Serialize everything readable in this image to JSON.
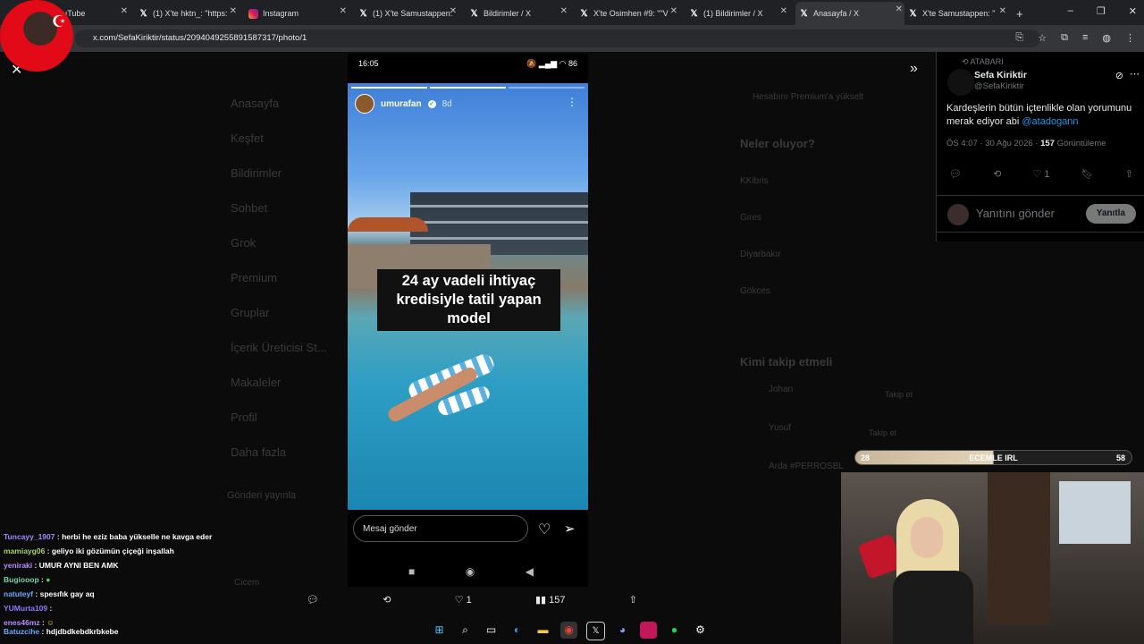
{
  "browser": {
    "tabs": [
      {
        "label": "YouTube",
        "icon": "youtube-icon"
      },
      {
        "label": "(1) X'te hktn_: \"https:",
        "icon": "x-icon"
      },
      {
        "label": "Instagram",
        "icon": "instagram-icon"
      },
      {
        "label": "(1) X'te Samustappen: ",
        "icon": "x-icon"
      },
      {
        "label": "Bildirimler / X",
        "icon": "x-icon"
      },
      {
        "label": "X'te Osimhen #9: \"\"V",
        "icon": "x-icon"
      },
      {
        "label": "(1) Bildirimler / X",
        "icon": "x-icon"
      },
      {
        "label": "Anasayfa / X",
        "icon": "x-icon",
        "active": true
      },
      {
        "label": "X'te Samustappen: \"",
        "icon": "x-icon"
      }
    ],
    "new_tab": "+",
    "url": "x.com/SefaKiriktir/status/2094049255891587317/photo/1",
    "window_controls": [
      "–",
      "❐",
      "✕"
    ]
  },
  "background_page": {
    "nav": [
      "Anasayfa",
      "Keşfet",
      "Bildirimler",
      "Sohbet",
      "Grok",
      "Premium",
      "Gruplar",
      "İçerik Üreticisi St...",
      "Makaleler",
      "Profil",
      "Daha fazla"
    ],
    "post_button": "Gönderi yayınla",
    "right_header": "Neler oluyor?",
    "premium_banner": "Hesabını Premium'a yükselt",
    "trends": [
      "KKibris",
      "Gires",
      "Diyarbakır",
      "Gökces"
    ],
    "follow_header": "Kimi takip etmeli",
    "follow_names": [
      "Johan",
      "Yusuf",
      "Arda #PERROSBL"
    ],
    "follow_buttons": [
      "Takip et",
      "Takip et"
    ],
    "bottom_user": "Cicem"
  },
  "phone": {
    "time": "16:05",
    "status_icons": "🔕 ▂▄▆ ◠ 86",
    "story_user": "umurafan",
    "story_time": "8d",
    "caption": "24 ay vadeli ihtiyaç kredisiyle tatil yapan model",
    "message_placeholder": "Mesaj gönder",
    "nav_buttons": [
      "■",
      "◉",
      "◀"
    ]
  },
  "tweet": {
    "repost_label": "ATABARI",
    "name": "Sefa Kiriktir",
    "handle": "@SefaKiriktir",
    "text": "Kardeşlerin bütün içtenlikle olan yorumunu merak ediyor abi ",
    "mention": "@atadogann",
    "timestamp": "ÖS 4:07 · 30 Ağu 2026 · ",
    "views_count": "157",
    "views_label": " Görüntüleme",
    "like_count": "1",
    "reply_placeholder": "Yanıtını gönder",
    "reply_button": "Yanıtla"
  },
  "modal_actions": {
    "like_count": "1",
    "views": "157"
  },
  "stream": {
    "left_score": "28",
    "title": "ECEMLE IRL",
    "right_score": "58"
  },
  "chat": [
    {
      "user": "Tuncayy_1907",
      "msg": "herbi he eziz baba yükselle ne kavga eder"
    },
    {
      "user": "mamiayg06",
      "msg": "geliyo iki gözümün çiçeği inşallah"
    },
    {
      "user": "yeniraki",
      "msg": "UMUR AYNI BEN AMK"
    },
    {
      "user": "Bugiooop",
      "msg": ""
    },
    {
      "user": "natuteyf",
      "msg": "spesıfık gay aq"
    },
    {
      "user": "YUMurta109",
      "msg": ""
    },
    {
      "user": "enes46mz",
      "msg": ""
    },
    {
      "user": "Batuzcihe",
      "msg": "hdjdbdkebdkrbkebe"
    }
  ]
}
